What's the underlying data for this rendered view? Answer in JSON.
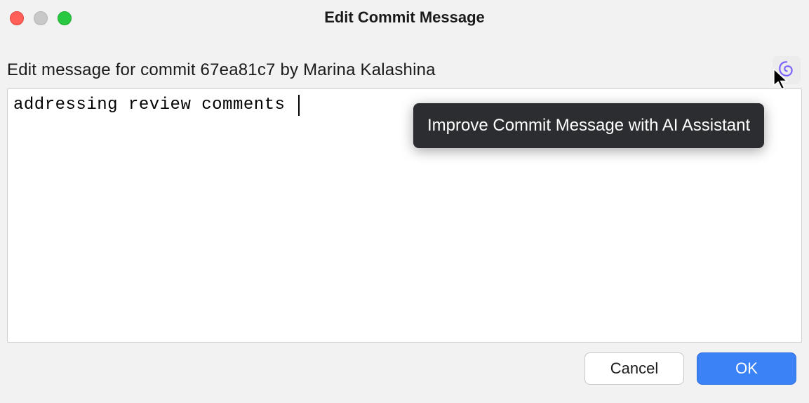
{
  "window": {
    "title": "Edit Commit Message"
  },
  "header": {
    "subtitle": "Edit message for commit 67ea81c7 by Marina Kalashina"
  },
  "editor": {
    "value": "addressing review comments"
  },
  "ai": {
    "tooltip": "Improve Commit Message with AI Assistant"
  },
  "buttons": {
    "cancel": "Cancel",
    "ok": "OK"
  }
}
